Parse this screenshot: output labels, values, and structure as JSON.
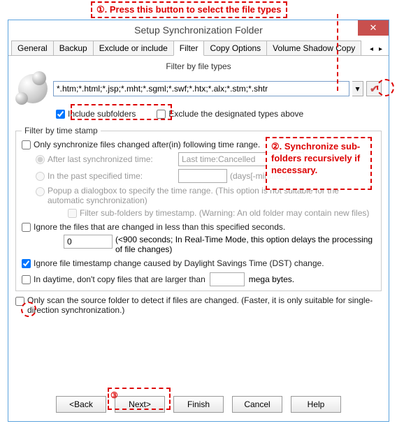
{
  "annotations": {
    "a1": "①. Press this button to select the file types",
    "a2": "②. Synchronize sub-folders recursively if necessary.",
    "a3_num": "③"
  },
  "window": {
    "title": "Setup Synchronization Folder"
  },
  "tabs": {
    "t0": "General",
    "t1": "Backup",
    "t2": "Exclude or include",
    "t3": "Filter",
    "t4": "Copy Options",
    "t5": "Volume Shadow Copy"
  },
  "filter_section": {
    "label": "Filter by file types",
    "value": "*.htm;*.html;*.jsp;*.mht;*.sgml;*.swf;*.htx;*.alx;*.stm;*.shtr",
    "include_subfolders": "Include subfolders",
    "exclude_designated": "Exclude the designated types above"
  },
  "timestamp_section": {
    "legend": "Filter by time stamp",
    "only_sync": "Only synchronize files changed after(in) following time range.",
    "after_last": "After last synchronized time:",
    "last_time_value": "Last time:Cancelled",
    "in_past": "In the past specified time:",
    "days_minutes": "(days[-minutes])",
    "popup": "Popup a dialogbox to specify the time range. (This option is not suitable for the automatic synchronization)",
    "filter_subfolders": "Filter sub-folders by timestamp. (Warning: An old folder may contain new files)",
    "ignore_seconds": "Ignore the files that are changed in less than this specified seconds.",
    "seconds_value": "0",
    "seconds_hint": "(<900 seconds; In Real-Time Mode, this option delays the processing of file changes)",
    "ignore_dst": "Ignore file timestamp change caused by Daylight Savings Time (DST) change.",
    "daytime_limit": "In daytime, don't copy files that are larger than",
    "daytime_suffix": "mega bytes."
  },
  "scan_only": "Only scan the source folder to detect if files are changed. (Faster, it is only suitable for single-direction synchronization.)",
  "buttons": {
    "back": "<Back",
    "next": "Next>",
    "finish": "Finish",
    "cancel": "Cancel",
    "help": "Help"
  }
}
